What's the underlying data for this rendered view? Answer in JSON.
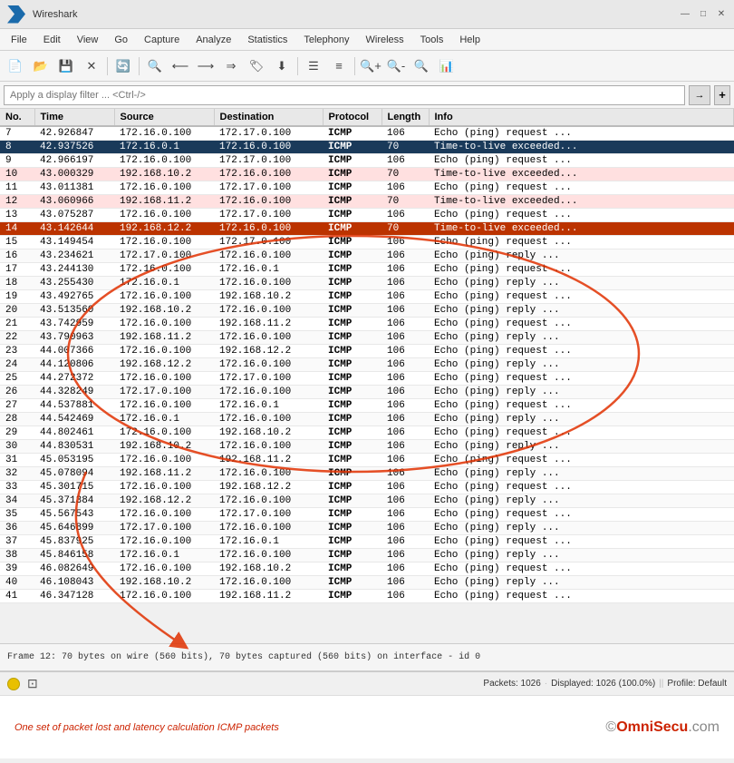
{
  "titleBar": {
    "title": "Wireshark",
    "controls": [
      "—",
      "□",
      "✕"
    ]
  },
  "menuBar": {
    "items": [
      "File",
      "Edit",
      "View",
      "Go",
      "Capture",
      "Analyze",
      "Statistics",
      "Telephony",
      "Wireless",
      "Tools",
      "Help"
    ]
  },
  "filterBar": {
    "placeholder": "Apply a display filter ... <Ctrl-/>",
    "arrow_label": "→",
    "plus_label": "+"
  },
  "table": {
    "columns": [
      "No.",
      "Time",
      "Source",
      "Destination",
      "Protocol",
      "Length",
      "Info"
    ],
    "rows": [
      {
        "no": "7",
        "time": "42.926847",
        "src": "172.16.0.100",
        "dst": "172.17.0.100",
        "proto": "ICMP",
        "len": "106",
        "info": "Echo (ping) request  ...",
        "style": "normal"
      },
      {
        "no": "8",
        "time": "42.937526",
        "src": "172.16.0.1",
        "dst": "172.16.0.100",
        "proto": "ICMP",
        "len": "70",
        "info": "Time-to-live exceeded...",
        "style": "dark-selected"
      },
      {
        "no": "9",
        "time": "42.966197",
        "src": "172.16.0.100",
        "dst": "172.17.0.100",
        "proto": "ICMP",
        "len": "106",
        "info": "Echo (ping) request  ...",
        "style": "normal"
      },
      {
        "no": "10",
        "time": "43.000329",
        "src": "192.168.10.2",
        "dst": "172.16.0.100",
        "proto": "ICMP",
        "len": "70",
        "info": "Time-to-live exceeded...",
        "style": "pink"
      },
      {
        "no": "11",
        "time": "43.011381",
        "src": "172.16.0.100",
        "dst": "172.17.0.100",
        "proto": "ICMP",
        "len": "106",
        "info": "Echo (ping) request  ...",
        "style": "normal"
      },
      {
        "no": "12",
        "time": "43.060966",
        "src": "192.168.11.2",
        "dst": "172.16.0.100",
        "proto": "ICMP",
        "len": "70",
        "info": "Time-to-live exceeded...",
        "style": "pink"
      },
      {
        "no": "13",
        "time": "43.075287",
        "src": "172.16.0.100",
        "dst": "172.17.0.100",
        "proto": "ICMP",
        "len": "106",
        "info": "Echo (ping) request  ...",
        "style": "normal"
      },
      {
        "no": "14",
        "time": "43.142644",
        "src": "192.168.12.2",
        "dst": "172.16.0.100",
        "proto": "ICMP",
        "len": "70",
        "info": "Time-to-live exceeded...",
        "style": "orange-selected"
      },
      {
        "no": "15",
        "time": "43.149454",
        "src": "172.16.0.100",
        "dst": "172.17.0.100",
        "proto": "ICMP",
        "len": "106",
        "info": "Echo (ping) request  ...",
        "style": "normal"
      },
      {
        "no": "16",
        "time": "43.234621",
        "src": "172.17.0.100",
        "dst": "172.16.0.100",
        "proto": "ICMP",
        "len": "106",
        "info": "Echo (ping) reply    ...",
        "style": "normal"
      },
      {
        "no": "17",
        "time": "43.244130",
        "src": "172.16.0.100",
        "dst": "172.16.0.1",
        "proto": "ICMP",
        "len": "106",
        "info": "Echo (ping) request  ...",
        "style": "normal"
      },
      {
        "no": "18",
        "time": "43.255430",
        "src": "172.16.0.1",
        "dst": "172.16.0.100",
        "proto": "ICMP",
        "len": "106",
        "info": "Echo (ping) reply    ...",
        "style": "normal"
      },
      {
        "no": "19",
        "time": "43.492765",
        "src": "172.16.0.100",
        "dst": "192.168.10.2",
        "proto": "ICMP",
        "len": "106",
        "info": "Echo (ping) request  ...",
        "style": "normal"
      },
      {
        "no": "20",
        "time": "43.513560",
        "src": "192.168.10.2",
        "dst": "172.16.0.100",
        "proto": "ICMP",
        "len": "106",
        "info": "Echo (ping) reply    ...",
        "style": "normal"
      },
      {
        "no": "21",
        "time": "43.742959",
        "src": "172.16.0.100",
        "dst": "192.168.11.2",
        "proto": "ICMP",
        "len": "106",
        "info": "Echo (ping) request  ...",
        "style": "normal"
      },
      {
        "no": "22",
        "time": "43.790963",
        "src": "192.168.11.2",
        "dst": "172.16.0.100",
        "proto": "ICMP",
        "len": "106",
        "info": "Echo (ping) reply    ...",
        "style": "normal"
      },
      {
        "no": "23",
        "time": "44.007366",
        "src": "172.16.0.100",
        "dst": "192.168.12.2",
        "proto": "ICMP",
        "len": "106",
        "info": "Echo (ping) request  ...",
        "style": "normal"
      },
      {
        "no": "24",
        "time": "44.120806",
        "src": "192.168.12.2",
        "dst": "172.16.0.100",
        "proto": "ICMP",
        "len": "106",
        "info": "Echo (ping) reply    ...",
        "style": "normal"
      },
      {
        "no": "25",
        "time": "44.272372",
        "src": "172.16.0.100",
        "dst": "172.17.0.100",
        "proto": "ICMP",
        "len": "106",
        "info": "Echo (ping) request  ...",
        "style": "normal"
      },
      {
        "no": "26",
        "time": "44.328249",
        "src": "172.17.0.100",
        "dst": "172.16.0.100",
        "proto": "ICMP",
        "len": "106",
        "info": "Echo (ping) reply    ...",
        "style": "normal"
      },
      {
        "no": "27",
        "time": "44.537881",
        "src": "172.16.0.100",
        "dst": "172.16.0.1",
        "proto": "ICMP",
        "len": "106",
        "info": "Echo (ping) request  ...",
        "style": "normal"
      },
      {
        "no": "28",
        "time": "44.542469",
        "src": "172.16.0.1",
        "dst": "172.16.0.100",
        "proto": "ICMP",
        "len": "106",
        "info": "Echo (ping) reply    ...",
        "style": "normal"
      },
      {
        "no": "29",
        "time": "44.802461",
        "src": "172.16.0.100",
        "dst": "192.168.10.2",
        "proto": "ICMP",
        "len": "106",
        "info": "Echo (ping) request  ...",
        "style": "normal"
      },
      {
        "no": "30",
        "time": "44.830531",
        "src": "192.168.10.2",
        "dst": "172.16.0.100",
        "proto": "ICMP",
        "len": "106",
        "info": "Echo (ping) reply    ...",
        "style": "normal"
      },
      {
        "no": "31",
        "time": "45.053195",
        "src": "172.16.0.100",
        "dst": "192.168.11.2",
        "proto": "ICMP",
        "len": "106",
        "info": "Echo (ping) request  ...",
        "style": "normal"
      },
      {
        "no": "32",
        "time": "45.078094",
        "src": "192.168.11.2",
        "dst": "172.16.0.100",
        "proto": "ICMP",
        "len": "106",
        "info": "Echo (ping) reply    ...",
        "style": "normal"
      },
      {
        "no": "33",
        "time": "45.301715",
        "src": "172.16.0.100",
        "dst": "192.168.12.2",
        "proto": "ICMP",
        "len": "106",
        "info": "Echo (ping) request  ...",
        "style": "normal"
      },
      {
        "no": "34",
        "time": "45.371384",
        "src": "192.168.12.2",
        "dst": "172.16.0.100",
        "proto": "ICMP",
        "len": "106",
        "info": "Echo (ping) reply    ...",
        "style": "normal"
      },
      {
        "no": "35",
        "time": "45.567543",
        "src": "172.16.0.100",
        "dst": "172.17.0.100",
        "proto": "ICMP",
        "len": "106",
        "info": "Echo (ping) request  ...",
        "style": "normal"
      },
      {
        "no": "36",
        "time": "45.646899",
        "src": "172.17.0.100",
        "dst": "172.16.0.100",
        "proto": "ICMP",
        "len": "106",
        "info": "Echo (ping) reply    ...",
        "style": "normal"
      },
      {
        "no": "37",
        "time": "45.837925",
        "src": "172.16.0.100",
        "dst": "172.16.0.1",
        "proto": "ICMP",
        "len": "106",
        "info": "Echo (ping) request  ...",
        "style": "normal"
      },
      {
        "no": "38",
        "time": "45.846158",
        "src": "172.16.0.1",
        "dst": "172.16.0.100",
        "proto": "ICMP",
        "len": "106",
        "info": "Echo (ping) reply    ...",
        "style": "normal"
      },
      {
        "no": "39",
        "time": "46.082649",
        "src": "172.16.0.100",
        "dst": "192.168.10.2",
        "proto": "ICMP",
        "len": "106",
        "info": "Echo (ping) request  ...",
        "style": "normal"
      },
      {
        "no": "40",
        "time": "46.108043",
        "src": "192.168.10.2",
        "dst": "172.16.0.100",
        "proto": "ICMP",
        "len": "106",
        "info": "Echo (ping) reply    ...",
        "style": "normal"
      },
      {
        "no": "41",
        "time": "46.347128",
        "src": "172.16.0.100",
        "dst": "192.168.11.2",
        "proto": "ICMP",
        "len": "106",
        "info": "Echo (ping) request  ...",
        "style": "normal"
      }
    ]
  },
  "detailPanel": {
    "text": "Frame 12: 70 bytes on wire (560 bits), 70 bytes captured (560 bits) on interface - id 0"
  },
  "statusBar": {
    "packets_label": "Packets: 1026",
    "displayed_label": "Displayed: 1026 (100.0%)",
    "profile_label": "Profile: Default"
  },
  "annotation": {
    "text": "One set of packet lost and latency calculation ICMP packets",
    "watermark": "©OmniSecu.com"
  },
  "colors": {
    "dark_selected_bg": "#1a3a5a",
    "dark_selected_text": "#ffffff",
    "orange_selected_bg": "#cc4400",
    "orange_selected_text": "#ffffff",
    "pink_bg": "#ffe0e0",
    "normal_bg": "#ffffff"
  }
}
